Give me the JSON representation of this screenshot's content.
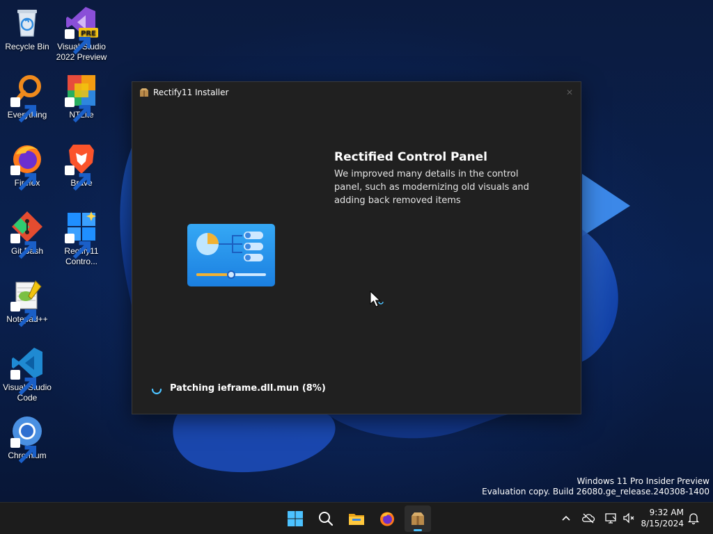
{
  "desktop": {
    "icons": [
      {
        "label": "Recycle Bin",
        "icon": "recycle-bin-icon"
      },
      {
        "label": "Visual Studio 2022 Preview",
        "icon": "visual-studio-icon",
        "badge": "PRE"
      },
      {
        "label": "Everything",
        "icon": "everything-icon"
      },
      {
        "label": "NTLite",
        "icon": "ntlite-icon"
      },
      {
        "label": "Firefox",
        "icon": "firefox-icon"
      },
      {
        "label": "Brave",
        "icon": "brave-icon"
      },
      {
        "label": "Git Bash",
        "icon": "git-bash-icon"
      },
      {
        "label": "Rectify11 Contro...",
        "icon": "rectify11-control-icon"
      },
      {
        "label": "Notepad++",
        "icon": "notepad-plus-plus-icon"
      },
      {
        "label": "Visual Studio Code",
        "icon": "vscode-icon"
      },
      {
        "label": "Chromium",
        "icon": "chromium-icon"
      }
    ]
  },
  "installer": {
    "title": "Rectify11 Installer",
    "close_glyph": "✕",
    "feature_title": "Rectified Control Panel",
    "feature_description": "We improved many details in the control panel, such as modernizing old visuals and adding back removed items",
    "status_text": "Patching ieframe.dll.mun (8%)",
    "progress_percent": 8
  },
  "watermark": {
    "line1": "Windows 11 Pro Insider Preview",
    "line2": "Evaluation copy. Build 26080.ge_release.240308-1400"
  },
  "taskbar": {
    "apps": [
      {
        "name": "start",
        "icon": "windows-start-icon"
      },
      {
        "name": "search",
        "icon": "search-icon"
      },
      {
        "name": "file-explorer",
        "icon": "folder-icon"
      },
      {
        "name": "firefox",
        "icon": "firefox-icon"
      },
      {
        "name": "rectify11-installer",
        "icon": "installer-icon",
        "active": true
      }
    ],
    "tray_icons": [
      "chevron-up-icon",
      "onedrive-offline-icon",
      "network-icon",
      "volume-muted-icon",
      "notification-bell-icon"
    ],
    "time": "9:32 AM",
    "date": "8/15/2024"
  },
  "colors": {
    "accent": "#4cc2ff",
    "window_bg": "#202020",
    "taskbar_bg": "#1c1c1c"
  }
}
